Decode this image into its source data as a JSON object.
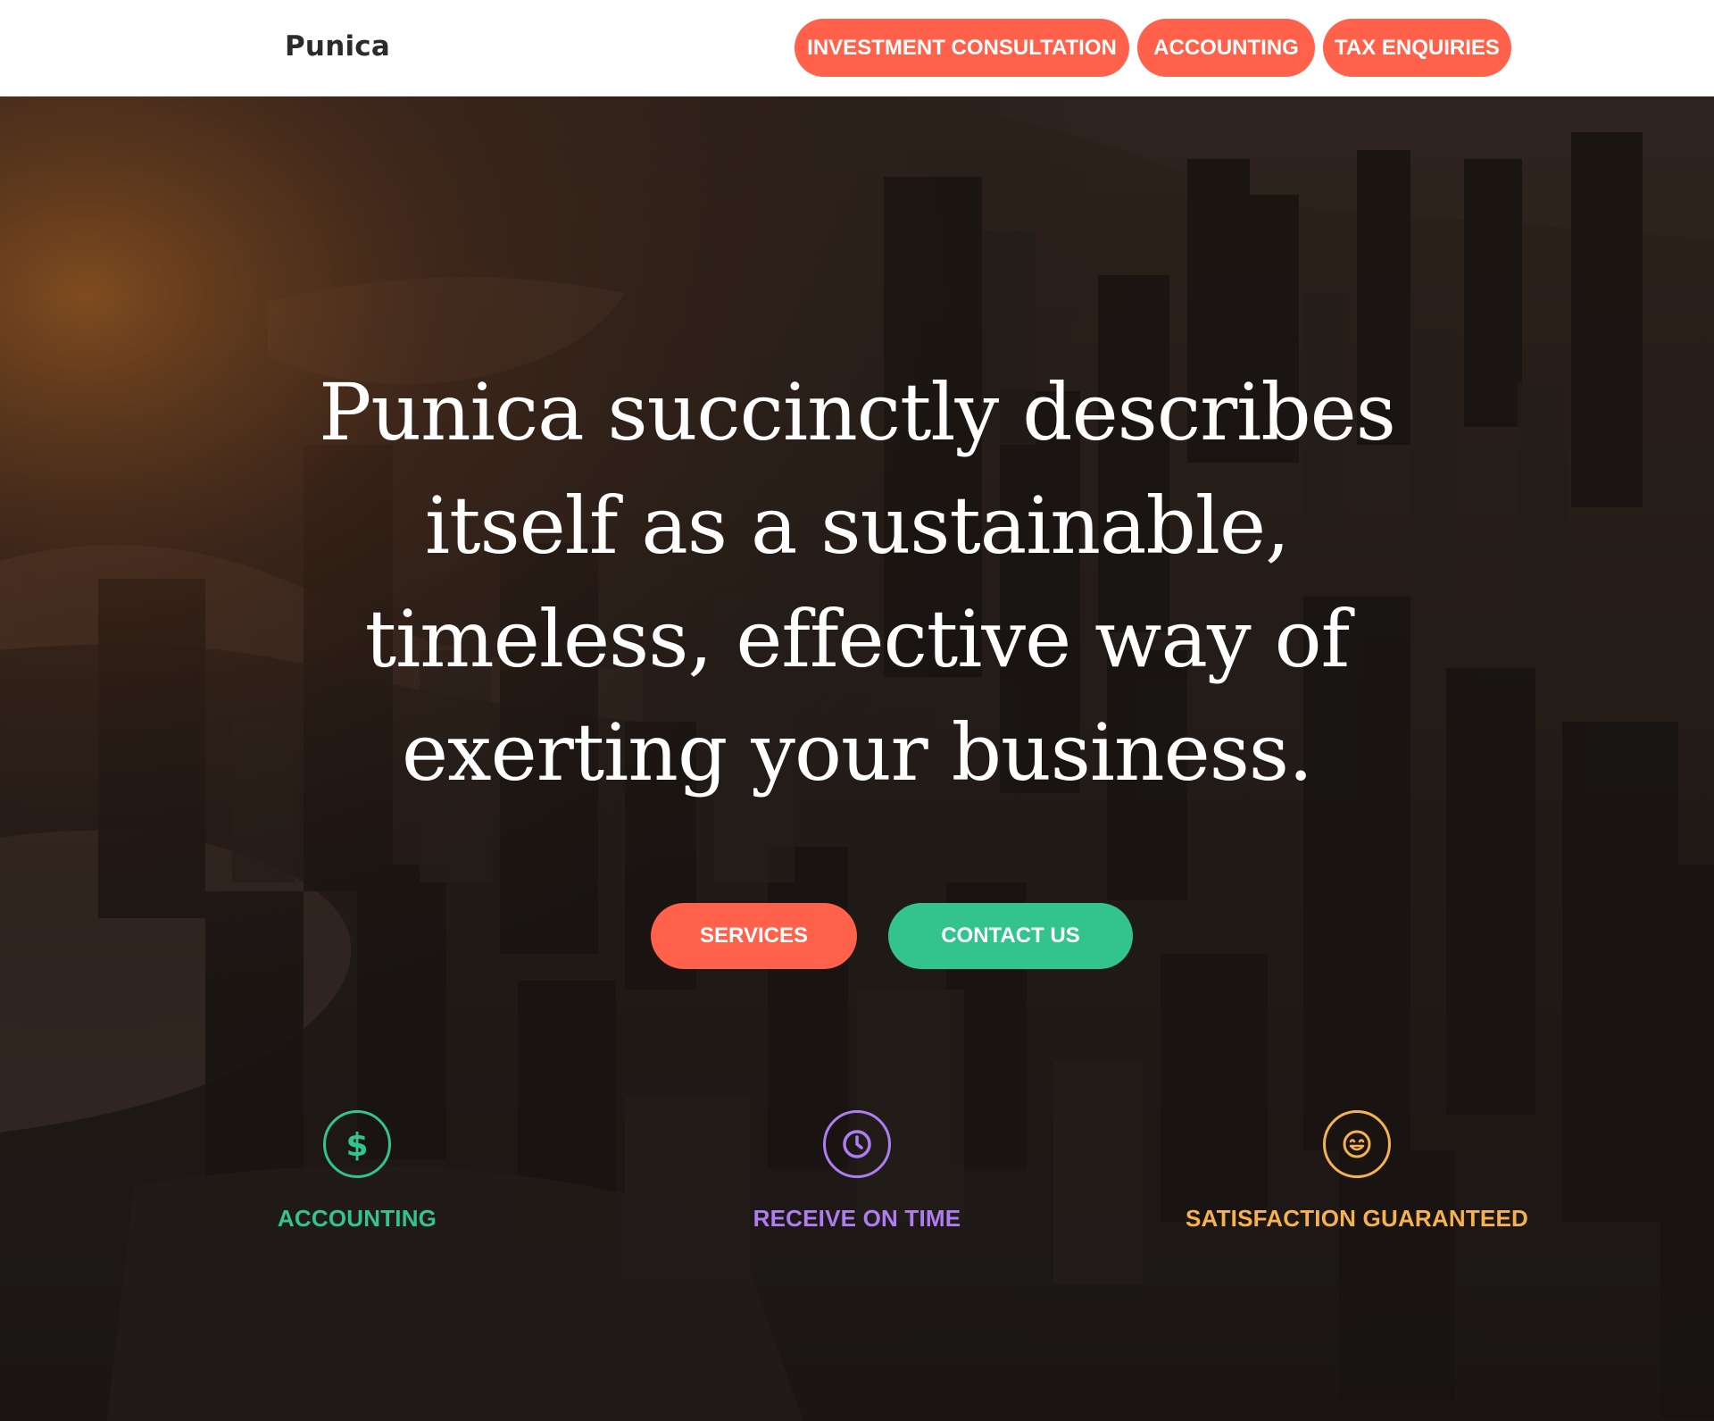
{
  "header": {
    "brand": "Punica",
    "nav": [
      {
        "label": "INVESTMENT CONSULTATION"
      },
      {
        "label": "ACCOUNTING"
      },
      {
        "label": "TAX ENQUIRIES"
      }
    ]
  },
  "hero": {
    "headline": "Punica succinctly describes itself as a sustainable, timeless, effective way of exerting your business.",
    "buttons": {
      "services": "SERVICES",
      "contact": "CONTACT US"
    },
    "features": [
      {
        "label": "ACCOUNTING",
        "icon": "dollar-icon",
        "color": "#33c48e"
      },
      {
        "label": "RECEIVE ON TIME",
        "icon": "clock-icon",
        "color": "#b07cf2"
      },
      {
        "label": "SATISFACTION GUARANTEED",
        "icon": "smiley-icon",
        "color": "#f6b24f"
      }
    ]
  },
  "colors": {
    "accent": "#ff614b",
    "secondary": "#33c48e"
  }
}
